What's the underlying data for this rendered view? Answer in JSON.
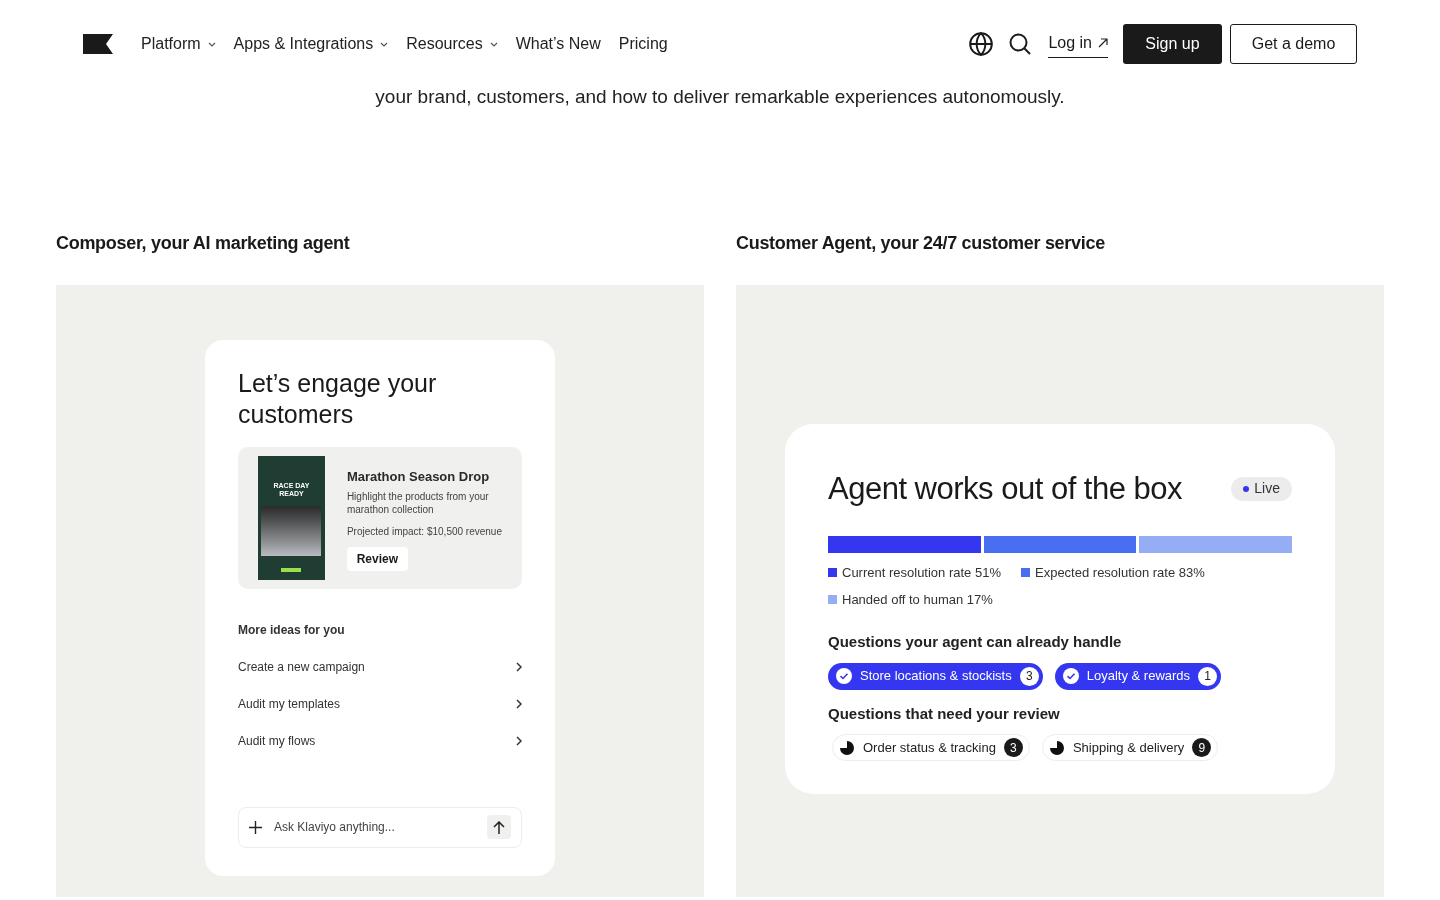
{
  "nav": {
    "items": [
      {
        "label": "Platform",
        "dropdown": true
      },
      {
        "label": "Apps & Integrations",
        "dropdown": true
      },
      {
        "label": "Resources",
        "dropdown": true
      },
      {
        "label": "What’s New",
        "dropdown": false
      },
      {
        "label": "Pricing",
        "dropdown": false
      }
    ],
    "login": "Log in",
    "signup": "Sign up",
    "demo": "Get a demo"
  },
  "intro_fragment": "your brand, customers, and how to deliver remarkable experiences autonomously.",
  "composer": {
    "heading": "Composer, your AI marketing agent",
    "card_title": "Let’s engage your customers",
    "email_preview": {
      "headline": "RACE DAY READY"
    },
    "suggestion": {
      "title": "Marathon Season Drop",
      "description": "Highlight the products from your marathon collection",
      "impact": "Projected impact: $10,500 revenue",
      "button": "Review"
    },
    "ideas_title": "More ideas for you",
    "ideas": [
      "Create a new campaign",
      "Audit my templates",
      "Audit my flows"
    ],
    "input": {
      "placeholder": "Ask Klaviyo anything..."
    }
  },
  "customer_agent": {
    "heading": "Customer Agent, your 24/7 customer service",
    "card_title": "Agent works out of the box",
    "badge": "Live",
    "legend": [
      {
        "label": "Current resolution rate 51%",
        "color": "#3537f0"
      },
      {
        "label": "Expected resolution rate 83%",
        "color": "#4a6ef0"
      },
      {
        "label": "Handed off to human 17%",
        "color": "#94adf5"
      }
    ],
    "groups": [
      {
        "title": "Questions your agent can already handle",
        "kind": "handled",
        "chips": [
          {
            "label": "Store locations & stockists",
            "count": "3"
          },
          {
            "label": "Loyalty & rewards",
            "count": "1"
          }
        ]
      },
      {
        "title": "Questions that need your review",
        "kind": "review",
        "chips": [
          {
            "label": "Order status & tracking",
            "count": "3"
          },
          {
            "label": "Shipping & delivery",
            "count": "9"
          }
        ]
      }
    ]
  }
}
